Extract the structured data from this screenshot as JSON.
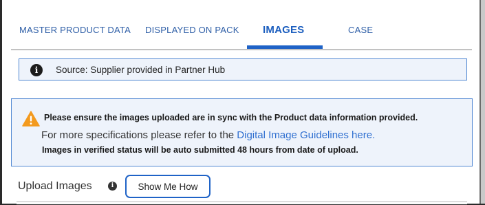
{
  "tabs": [
    {
      "label": "MASTER PRODUCT DATA",
      "active": false
    },
    {
      "label": "DISPLAYED ON PACK",
      "active": false
    },
    {
      "label": "IMAGES",
      "active": true
    },
    {
      "label": "CASE",
      "active": false
    }
  ],
  "source_bar": {
    "icon": "info-icon",
    "text": "Source: Supplier provided in Partner Hub"
  },
  "warning": {
    "icon": "warning-icon",
    "line1": "Please ensure the images uploaded are in sync with the Product data information provided.",
    "line2_prefix": "For more specifications please refer to the ",
    "line2_link": "Digital Image Guidelines here.",
    "line3": "Images in verified status will be auto submitted 48 hours from date of upload."
  },
  "upload": {
    "label": "Upload Images",
    "info_icon": "info-icon",
    "button_label": "Show Me How"
  },
  "colors": {
    "accent": "#1f63c7",
    "tab_text": "#2f5fa7",
    "panel_bg": "#eef3fb",
    "warning": "#f39a1f"
  }
}
